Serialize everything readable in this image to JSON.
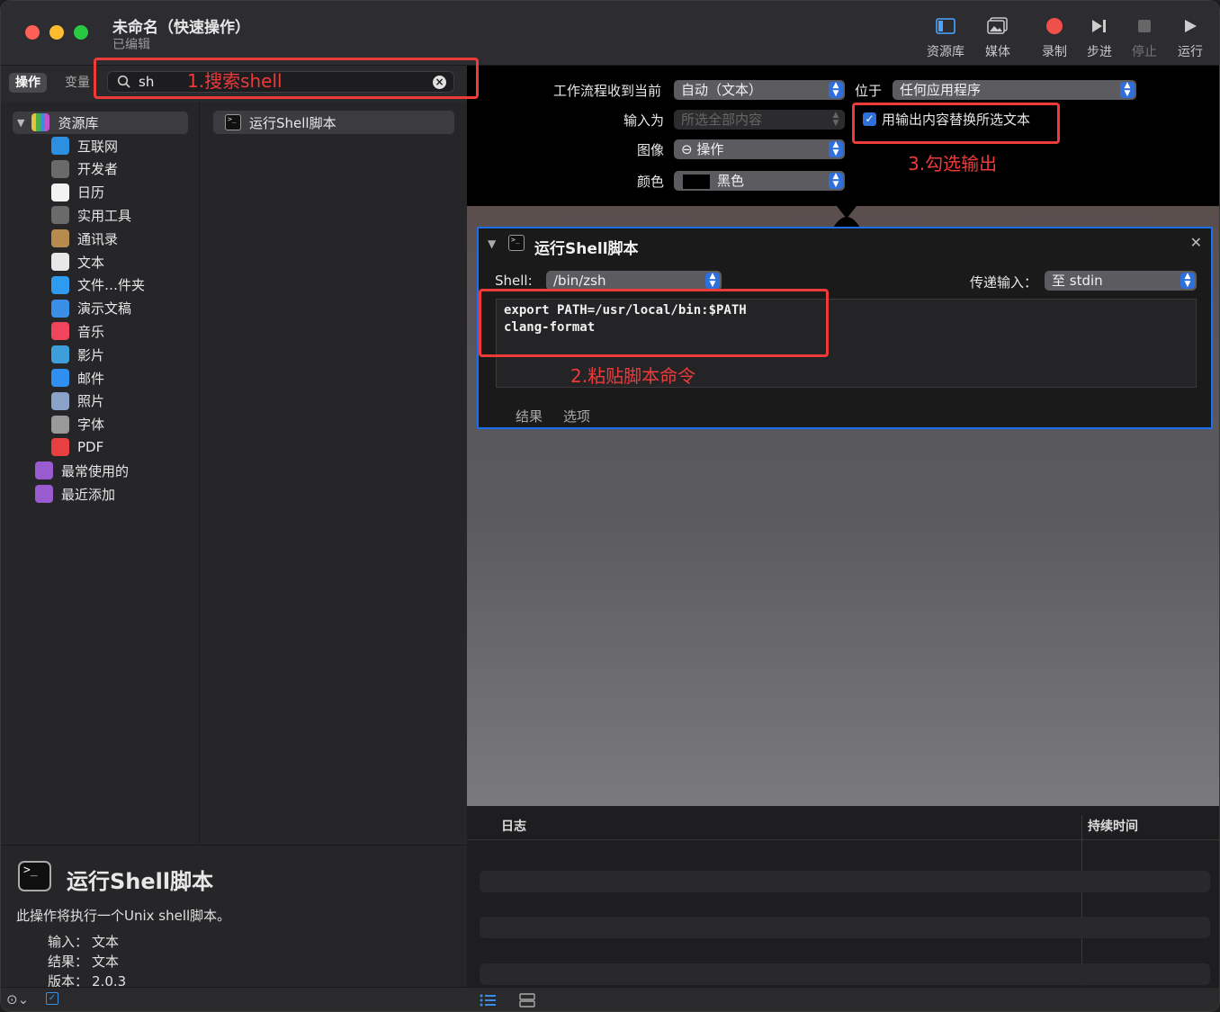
{
  "window": {
    "title": "未命名（快速操作）",
    "subtitle": "已编辑"
  },
  "toolbar": {
    "items": [
      {
        "label": "资源库",
        "icon": "sidebar-icon"
      },
      {
        "label": "媒体",
        "icon": "photo-icon"
      },
      {
        "label": "录制",
        "icon": "record-icon"
      },
      {
        "label": "步进",
        "icon": "step-icon"
      },
      {
        "label": "停止",
        "icon": "stop-icon"
      },
      {
        "label": "运行",
        "icon": "play-icon"
      }
    ]
  },
  "tabs": {
    "actions": "操作",
    "variables": "变量"
  },
  "search": {
    "value": "sh"
  },
  "library": {
    "root": "资源库",
    "items": [
      {
        "label": "互联网",
        "icon": "globe-icon",
        "color": "#2d8fe0"
      },
      {
        "label": "开发者",
        "icon": "tools-icon",
        "color": "#6a6a6a"
      },
      {
        "label": "日历",
        "icon": "calendar-icon",
        "color": "#f2f2f2"
      },
      {
        "label": "实用工具",
        "icon": "utilities-icon",
        "color": "#6a6a6a"
      },
      {
        "label": "通讯录",
        "icon": "contacts-icon",
        "color": "#b78a4e"
      },
      {
        "label": "文本",
        "icon": "text-icon",
        "color": "#e8e8e8"
      },
      {
        "label": "文件…件夹",
        "icon": "finder-icon",
        "color": "#2f9bf0"
      },
      {
        "label": "演示文稿",
        "icon": "keynote-icon",
        "color": "#3a8ee6"
      },
      {
        "label": "音乐",
        "icon": "music-icon",
        "color": "#f0455b"
      },
      {
        "label": "影片",
        "icon": "quicktime-icon",
        "color": "#3d9ed9"
      },
      {
        "label": "邮件",
        "icon": "mail-icon",
        "color": "#2e8ff0"
      },
      {
        "label": "照片",
        "icon": "photos-icon",
        "color": "#8aa2c8"
      },
      {
        "label": "字体",
        "icon": "font-icon",
        "color": "#999999"
      },
      {
        "label": "PDF",
        "icon": "pdf-icon",
        "color": "#e84040"
      }
    ],
    "smart": [
      {
        "label": "最常使用的",
        "icon": "smart-folder-icon",
        "color": "#9a5ad0"
      },
      {
        "label": "最近添加",
        "icon": "smart-folder-icon",
        "color": "#9a5ad0"
      }
    ]
  },
  "results": [
    {
      "label": "运行Shell脚本",
      "icon": "terminal-icon"
    }
  ],
  "description": {
    "title": "运行Shell脚本",
    "text": "此操作将执行一个Unix shell脚本。",
    "input_label": "输入：",
    "input_value": "文本",
    "result_label": "结果：",
    "result_value": "文本",
    "version_label": "版本：",
    "version_value": "2.0.3"
  },
  "workflow": {
    "receives_label": "工作流程收到当前",
    "receives_value": "自动（文本）",
    "location_label": "位于",
    "location_value": "任何应用程序",
    "input_is_label": "输入为",
    "input_is_value": "所选全部内容",
    "replace_label": "用输出内容替换所选文本",
    "image_label": "图像",
    "image_value": "⊖ 操作",
    "color_label": "颜色",
    "color_value": "黑色"
  },
  "action": {
    "title": "运行Shell脚本",
    "shell_label": "Shell:",
    "shell_value": "/bin/zsh",
    "pass_label": "传递输入：",
    "pass_value": "至 stdin",
    "code_line1": "export PATH=/usr/local/bin:$PATH",
    "code_line2": "clang-format",
    "tab_results": "结果",
    "tab_options": "选项"
  },
  "log": {
    "col_log": "日志",
    "col_duration": "持续时间"
  },
  "annotations": {
    "step1": "1.搜索shell",
    "step2": "2.粘贴脚本命令",
    "step3": "3.勾选输出"
  },
  "colors": {
    "accent": "#2f6fdc",
    "annotation": "#ef3a3a"
  }
}
